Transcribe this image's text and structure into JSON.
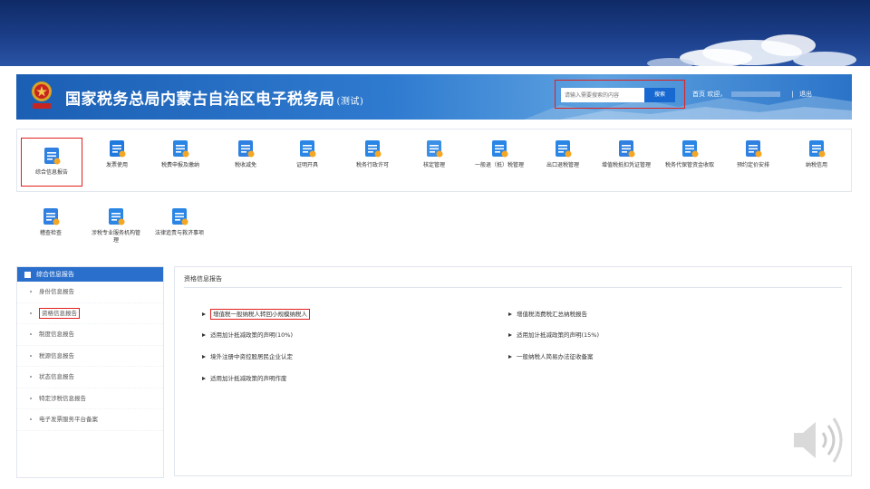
{
  "site": {
    "title": "国家税务总局内蒙古自治区电子税务局",
    "title_suffix": "(测试)",
    "search_placeholder": "请输入需要搜索的内容",
    "search_button": "搜索",
    "home_link": "首页",
    "welcome": "欢迎，",
    "separator": "|",
    "logout": "退出"
  },
  "icons_row1": [
    {
      "label": "综合信息报告",
      "icon": "document-user-icon",
      "color": "#2f80e0"
    },
    {
      "label": "发票使用",
      "icon": "invoice-icon",
      "color": "#1f78de"
    },
    {
      "label": "税费申报及缴纳",
      "icon": "tax-payment-icon",
      "color": "#2a86e4"
    },
    {
      "label": "税收减免",
      "icon": "checklist-icon",
      "color": "#2f80e0"
    },
    {
      "label": "证明开具",
      "icon": "folder-icon",
      "color": "#2a86e4"
    },
    {
      "label": "税务行政许可",
      "icon": "license-icon",
      "color": "#2a86e4"
    },
    {
      "label": "核定管理",
      "icon": "tax-check-icon",
      "color": "#3a8fe6"
    },
    {
      "label": "一般退（抵）税管理",
      "icon": "refund-icon",
      "color": "#2a86e4"
    },
    {
      "label": "出口退税管理",
      "icon": "export-refund-icon",
      "color": "#2a86e4"
    },
    {
      "label": "增值税抵扣凭证管理",
      "icon": "vat-voucher-icon",
      "color": "#2f80e0"
    },
    {
      "label": "税务代保管资金收取",
      "icon": "custody-fund-icon",
      "color": "#2a86e4"
    },
    {
      "label": "预约定价安排",
      "icon": "calendar-icon",
      "color": "#2f80e0"
    },
    {
      "label": "纳税信用",
      "icon": "credit-icon",
      "color": "#2a86e4"
    }
  ],
  "icons_row2": [
    {
      "label": "稽查检查",
      "icon": "inspection-shield-icon",
      "color": "#2f80e0"
    },
    {
      "label": "涉税专业服务机构管",
      "label2": "理",
      "icon": "agency-icon",
      "color": "#2a86e4"
    },
    {
      "label": "法律追责与救济事项",
      "icon": "law-book-icon",
      "color": "#2a86e4"
    }
  ],
  "sidebar": {
    "header": "综合信息报告",
    "items": [
      {
        "label": "身份信息报告"
      },
      {
        "label": "资格信息报告"
      },
      {
        "label": "制度信息报告"
      },
      {
        "label": "税源信息报告"
      },
      {
        "label": "状态信息报告"
      },
      {
        "label": "特定涉税信息报告"
      },
      {
        "label": "电子发票服务平台备案"
      }
    ]
  },
  "main": {
    "title": "资格信息报告",
    "links_left": [
      "增值税一般纳税人转回小规模纳税人",
      "适用加计抵减政策的声明(10%)",
      "境外注册中资控股居民企业认定",
      "适用加计抵减政策的声明作废"
    ],
    "links_right": [
      "增值税消费税汇总纳税报告",
      "适用加计抵减政策的声明(15%)",
      "一般纳税人简易办法征收备案"
    ]
  },
  "colors": {
    "header_blue": "#1b5fb4",
    "accent_red": "#e0201e",
    "sidebar_blue": "#2a6fcc"
  }
}
